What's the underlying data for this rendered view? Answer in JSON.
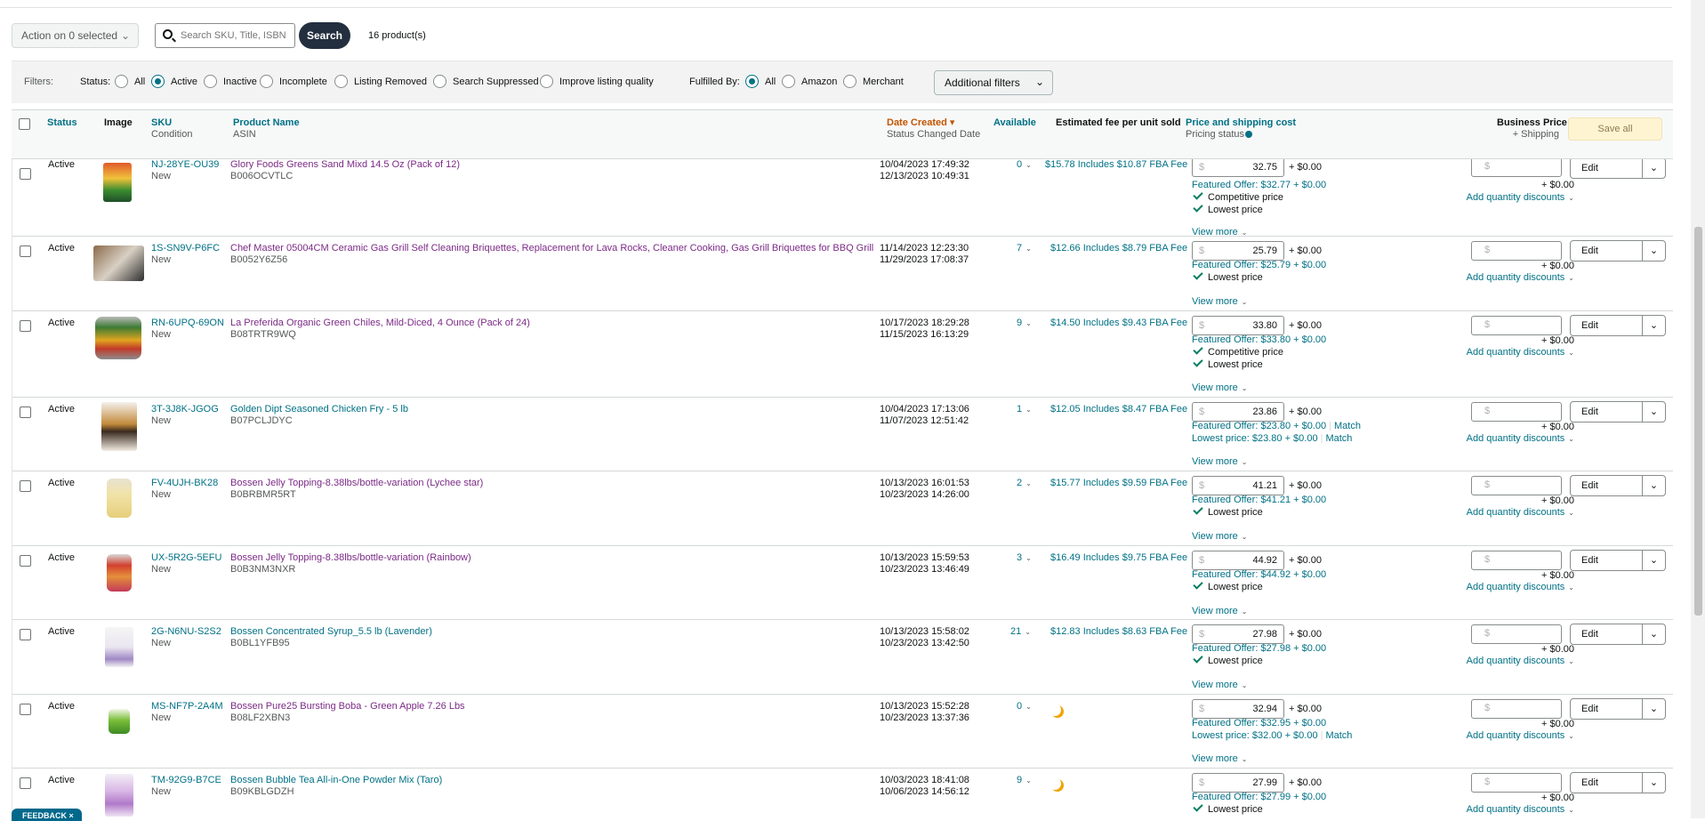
{
  "toolbar": {
    "action_label": "Action on 0 selected",
    "search_placeholder": "Search SKU, Title, ISBN",
    "search_button": "Search",
    "product_count": "16 product(s)"
  },
  "filters": {
    "label": "Filters:",
    "status_label": "Status:",
    "status_options": [
      {
        "label": "All",
        "selected": false
      },
      {
        "label": "Active",
        "selected": true
      },
      {
        "label": "Inactive",
        "selected": false
      },
      {
        "label": "Incomplete",
        "selected": false
      },
      {
        "label": "Listing Removed",
        "selected": false
      },
      {
        "label": "Search Suppressed",
        "selected": false
      },
      {
        "label": "Improve listing quality",
        "selected": false
      }
    ],
    "fulfilled_label": "Fulfilled By:",
    "fulfilled_options": [
      {
        "label": "All",
        "selected": true
      },
      {
        "label": "Amazon",
        "selected": false
      },
      {
        "label": "Merchant",
        "selected": false
      }
    ],
    "additional_filters": "Additional filters"
  },
  "header": {
    "status": "Status",
    "image": "Image",
    "sku": "SKU",
    "condition": "Condition",
    "product_name": "Product Name",
    "asin": "ASIN",
    "date_created": "Date Created",
    "status_changed": "Status Changed Date",
    "available": "Available",
    "est_fee": "Estimated fee per unit sold",
    "price_shipping": "Price and shipping cost",
    "pricing_status": "Pricing status",
    "business_price": "Business Price",
    "plus_shipping": "+ Shipping",
    "save_all": "Save all"
  },
  "common": {
    "status_active": "Active",
    "condition_new": "New",
    "plus_zero": "+ $0.00",
    "view_more": "View more",
    "add_qty_discounts": "Add quantity discounts",
    "edit": "Edit",
    "dollar": "$",
    "competitive_price": "Competitive price",
    "lowest_price": "Lowest price",
    "match": "Match"
  },
  "rows": [
    {
      "sku": "NJ-28YE-OU39",
      "name": "Glory Foods Greens Sand Mixd 14.5 Oz (Pack of 12)",
      "asin": "B006OCVTLC",
      "date_created": "10/04/2023 17:49:32",
      "status_changed": "12/13/2023 10:49:31",
      "available": "0",
      "fee": "$15.78 Includes $10.87 FBA Fee",
      "price": "32.75",
      "featured": "Featured Offer: $32.77 + $0.00",
      "competitive": true,
      "lowest": true,
      "lowest_text": ""
    },
    {
      "sku": "1S-SN9V-P6FC",
      "name": "Chef Master 05004CM Ceramic Gas Grill Self Cleaning Briquettes, Replacement for Lava Rocks, Cleaner Cooking, Gas Grill Briquettes for BBQ Grill",
      "asin": "B0052Y6Z56",
      "date_created": "11/14/2023 12:23:30",
      "status_changed": "11/29/2023 17:08:37",
      "available": "7",
      "fee": "$12.66 Includes $8.79 FBA Fee",
      "price": "25.79",
      "featured": "Featured Offer: $25.79 + $0.00",
      "competitive": false,
      "lowest": true,
      "lowest_text": ""
    },
    {
      "sku": "RN-6UPQ-69ON",
      "name": "La Preferida Organic Green Chiles, Mild-Diced, 4 Ounce (Pack of 24)",
      "asin": "B08TRTR9WQ",
      "date_created": "10/17/2023 18:29:28",
      "status_changed": "11/15/2023 16:13:29",
      "available": "9",
      "fee": "$14.50 Includes $9.43 FBA Fee",
      "price": "33.80",
      "featured": "Featured Offer: $33.80 + $0.00",
      "competitive": true,
      "lowest": true,
      "lowest_text": ""
    },
    {
      "sku": "3T-3J8K-JGOG",
      "name": "Golden Dipt Seasoned Chicken Fry - 5 lb",
      "asin": "B07PCLJDYC",
      "date_created": "10/04/2023 17:13:06",
      "status_changed": "11/07/2023 12:51:42",
      "available": "1",
      "fee": "$12.05 Includes $8.47 FBA Fee",
      "price": "23.86",
      "featured": "Featured Offer: $23.80 + $0.00",
      "featured_match": true,
      "competitive": false,
      "lowest": false,
      "lowest_text": "Lowest price: $23.80 + $0.00"
    },
    {
      "sku": "FV-4UJH-BK28",
      "name": "Bossen Jelly Topping-8.38lbs/bottle-variation (Lychee star)",
      "asin": "B0BRBMR5RT",
      "date_created": "10/13/2023 16:01:53",
      "status_changed": "10/23/2023 14:26:00",
      "available": "2",
      "fee": "$15.77 Includes $9.59 FBA Fee",
      "price": "41.21",
      "featured": "Featured Offer: $41.21 + $0.00",
      "competitive": false,
      "lowest": true,
      "lowest_text": ""
    },
    {
      "sku": "UX-5R2G-5EFU",
      "name": "Bossen Jelly Topping-8.38lbs/bottle-variation (Rainbow)",
      "asin": "B0B3NM3NXR",
      "date_created": "10/13/2023 15:59:53",
      "status_changed": "10/23/2023 13:46:49",
      "available": "3",
      "fee": "$16.49 Includes $9.75 FBA Fee",
      "price": "44.92",
      "featured": "Featured Offer: $44.92 + $0.00",
      "competitive": false,
      "lowest": true,
      "lowest_text": ""
    },
    {
      "sku": "2G-N6NU-S2S2",
      "name": "Bossen Concentrated Syrup_5.5 lb (Lavender)",
      "asin": "B0BL1YFB95",
      "date_created": "10/13/2023 15:58:02",
      "status_changed": "10/23/2023 13:42:50",
      "available": "21",
      "fee": "$12.83 Includes $8.63 FBA Fee",
      "price": "27.98",
      "featured": "Featured Offer: $27.98 + $0.00",
      "competitive": false,
      "lowest": true,
      "lowest_text": ""
    },
    {
      "sku": "MS-NF7P-2A4M",
      "name": "Bossen Pure25 Bursting Boba - Green Apple 7.26 Lbs",
      "asin": "B08LF2XBN3",
      "date_created": "10/13/2023 15:52:28",
      "status_changed": "10/23/2023 13:37:36",
      "available": "0",
      "fee": "",
      "price": "32.94",
      "featured": "Featured Offer: $32.95 + $0.00",
      "competitive": false,
      "lowest": false,
      "lowest_text": "Lowest price: $32.00 + $0.00",
      "lowest_match": true
    },
    {
      "sku": "TM-92G9-B7CE",
      "name": "Bossen Bubble Tea All-in-One Powder Mix (Taro)",
      "asin": "B09KBLGDZH",
      "date_created": "10/03/2023 18:41:08",
      "status_changed": "10/06/2023 14:56:12",
      "available": "9",
      "fee": "",
      "price": "27.99",
      "featured": "Featured Offer: $27.99 + $0.00",
      "competitive": false,
      "lowest": true,
      "lowest_text": ""
    }
  ],
  "feedback": "FEEDBACK"
}
